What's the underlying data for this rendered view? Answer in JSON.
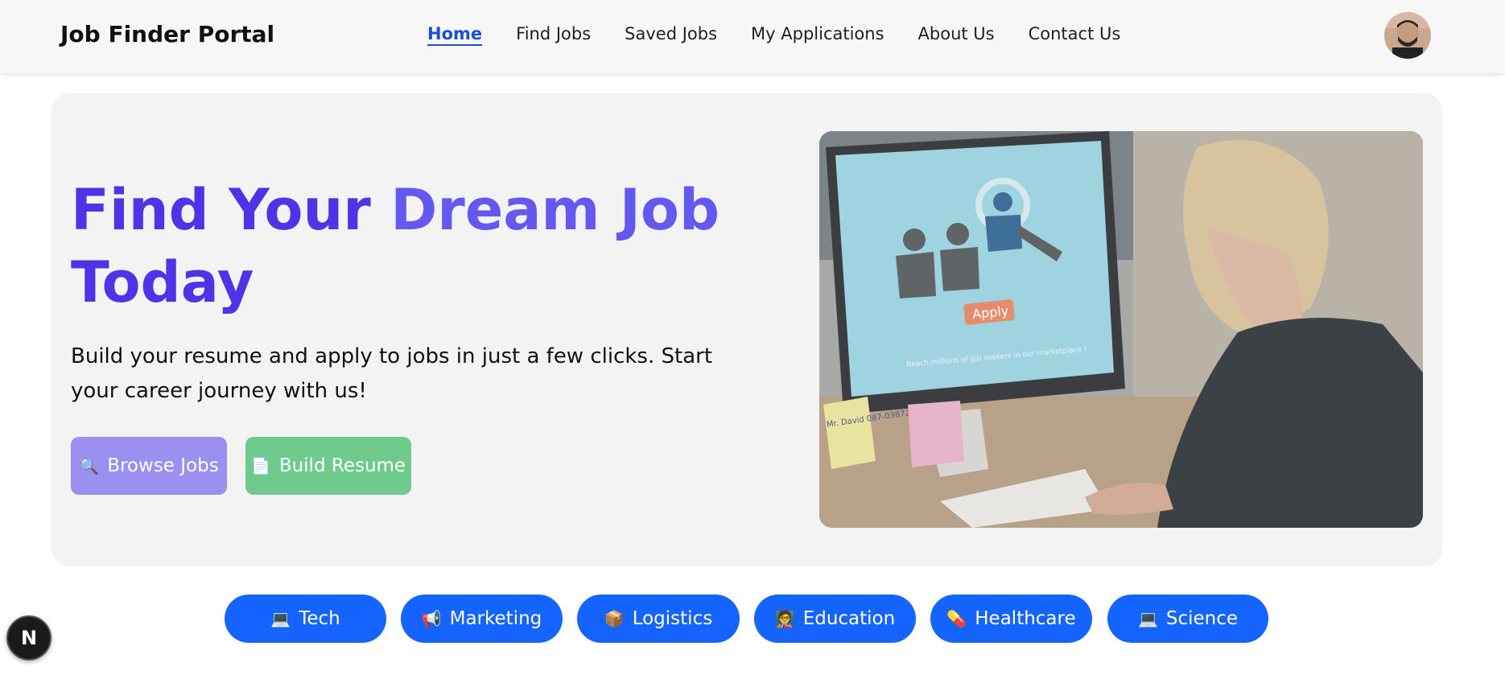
{
  "header": {
    "brand": "Job Finder Portal",
    "nav": [
      {
        "label": "Home",
        "active": true
      },
      {
        "label": "Find Jobs",
        "active": false
      },
      {
        "label": "Saved Jobs",
        "active": false
      },
      {
        "label": "My Applications",
        "active": false
      },
      {
        "label": "About Us",
        "active": false
      },
      {
        "label": "Contact Us",
        "active": false
      }
    ]
  },
  "hero": {
    "title_part1": "Find Your ",
    "title_accent": "Dream Job",
    "title_part2": "Today",
    "subtitle": "Build your resume and apply to jobs in just a few clicks. Start your career journey with us!",
    "browse_icon": "🔍",
    "browse_label": "Browse Jobs",
    "resume_icon": "📄",
    "resume_label": "Build Resume",
    "image_text": {
      "screen_button": "Apply",
      "screen_caption": "Reach millions of job seekers in our marketplace !",
      "sticky_note": "Mr. David 087-0387219"
    }
  },
  "categories": [
    {
      "icon": "💻",
      "label": "Tech"
    },
    {
      "icon": "📢",
      "label": "Marketing"
    },
    {
      "icon": "📦",
      "label": "Logistics"
    },
    {
      "icon": "🧑‍🏫",
      "label": "Education"
    },
    {
      "icon": "💊",
      "label": "Healthcare"
    },
    {
      "icon": "💻",
      "label": "Science"
    }
  ],
  "badge": {
    "letter": "N"
  },
  "colors": {
    "primary_blue": "#1664ff",
    "title_purple": "#4f33e6",
    "browse_button": "#9b8ff2",
    "resume_button": "#6fcb8b"
  }
}
